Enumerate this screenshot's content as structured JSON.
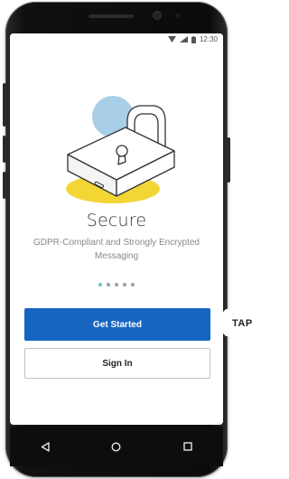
{
  "status_bar": {
    "time": "12:30",
    "icons": [
      "wifi-icon",
      "signal-icon",
      "battery-icon"
    ]
  },
  "onboarding": {
    "illustration": "padlock-icon",
    "title": "Secure",
    "subtitle": "GDPR-Compliant and Strongly Encrypted Messaging",
    "page_indicator": {
      "total": 5,
      "active_index": 0
    }
  },
  "actions": {
    "primary_label": "Get Started",
    "secondary_label": "Sign In"
  },
  "nav_bar": {
    "icons": [
      "back-icon",
      "home-icon",
      "recents-icon"
    ]
  },
  "annotation": {
    "label": "TAP"
  },
  "colors": {
    "primary": "#1565c0",
    "active_dot": "#5ec6c6",
    "illustration_blue": "#a9cfe8",
    "illustration_yellow": "#f3d634"
  }
}
